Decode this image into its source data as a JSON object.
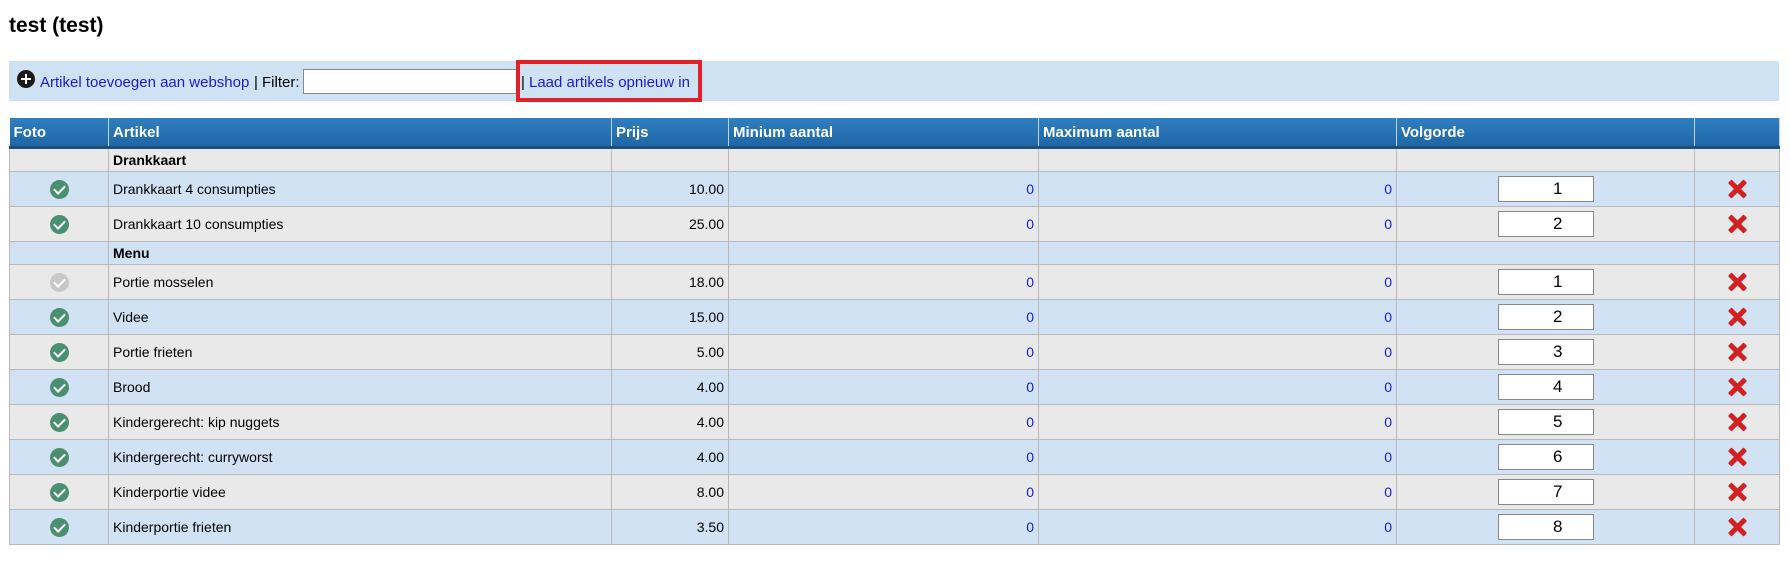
{
  "page": {
    "title": "test (test)"
  },
  "toolbar": {
    "add_label": "Artikel toevoegen aan webshop",
    "separator": "|",
    "filter_label": "Filter:",
    "filter_value": "",
    "reload_label": "Laad artikels opnieuw in"
  },
  "table": {
    "headers": [
      "Foto",
      "Artikel",
      "Prijs",
      "Minium aantal",
      "Maximum aantal",
      "Volgorde",
      ""
    ],
    "groups": [
      {
        "name": "Drankkaart",
        "rows": [
          {
            "photo": "check-icon",
            "name": "Drankkaart 4 consumpties",
            "price": "10.00",
            "min": "0",
            "max": "0",
            "order": "1"
          },
          {
            "photo": "check-icon",
            "name": "Drankkaart 10 consumpties",
            "price": "25.00",
            "min": "0",
            "max": "0",
            "order": "2"
          }
        ]
      },
      {
        "name": "Menu",
        "rows": [
          {
            "photo": "check-grey-icon",
            "name": "Portie mosselen",
            "price": "18.00",
            "min": "0",
            "max": "0",
            "order": "1"
          },
          {
            "photo": "check-icon",
            "name": "Videe",
            "price": "15.00",
            "min": "0",
            "max": "0",
            "order": "2"
          },
          {
            "photo": "check-icon",
            "name": "Portie frieten",
            "price": "5.00",
            "min": "0",
            "max": "0",
            "order": "3"
          },
          {
            "photo": "check-icon",
            "name": "Brood",
            "price": "4.00",
            "min": "0",
            "max": "0",
            "order": "4"
          },
          {
            "photo": "check-icon",
            "name": "Kindergerecht: kip nuggets",
            "price": "4.00",
            "min": "0",
            "max": "0",
            "order": "5"
          },
          {
            "photo": "check-icon",
            "name": "Kindergerecht: curryworst",
            "price": "4.00",
            "min": "0",
            "max": "0",
            "order": "6"
          },
          {
            "photo": "check-icon",
            "name": "Kinderportie videe",
            "price": "8.00",
            "min": "0",
            "max": "0",
            "order": "7"
          },
          {
            "photo": "check-icon",
            "name": "Kinderportie frieten",
            "price": "3.50",
            "min": "0",
            "max": "0",
            "order": "8"
          }
        ]
      }
    ]
  },
  "colors": {
    "accent_link": "#1a1ad6",
    "header_bg": "#2f7fc0",
    "highlight_border": "#e0202a",
    "check_green": "#4a9070",
    "delete_red": "#d42020"
  }
}
